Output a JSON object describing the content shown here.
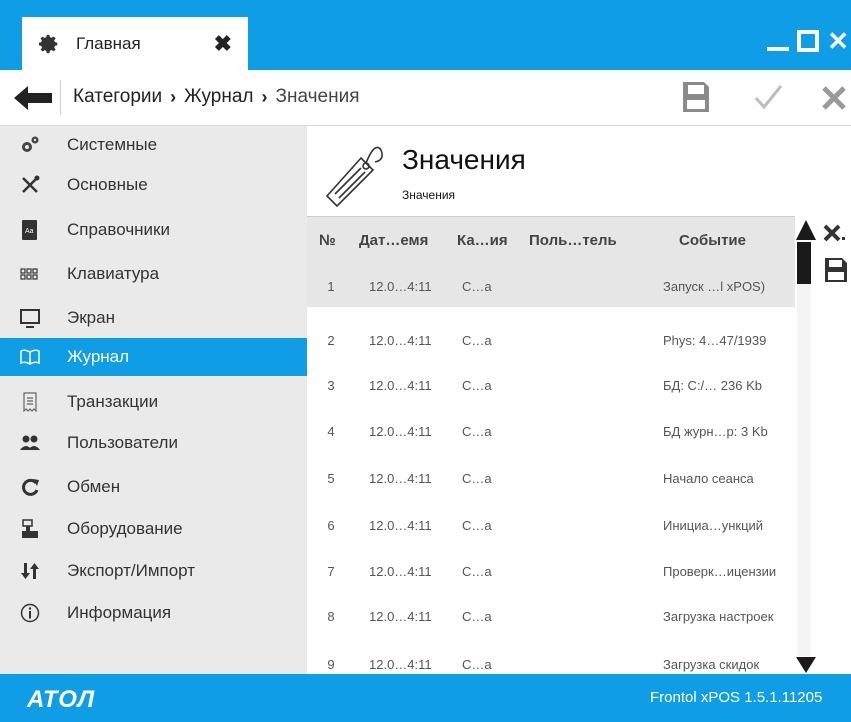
{
  "tab": {
    "title": "Главная",
    "close_glyph": "✖",
    "icon": "gear-icon"
  },
  "window": {
    "close_glyph": "✕"
  },
  "breadcrumb": {
    "back_icon": "back-arrow-icon",
    "items": [
      "Категории",
      "Журнал",
      "Значения"
    ],
    "separator": "›"
  },
  "actions": {
    "save_icon": "save-icon",
    "confirm_icon": "check-icon",
    "cancel_icon": "cancel-icon"
  },
  "sidebar": {
    "items": [
      {
        "label": "Системные",
        "icon": "gears-icon"
      },
      {
        "label": "Основные",
        "icon": "tools-icon"
      },
      {
        "label": "Справочники",
        "icon": "book-icon"
      },
      {
        "label": "Клавиатура",
        "icon": "keyboard-icon"
      },
      {
        "label": "Экран",
        "icon": "monitor-icon"
      },
      {
        "label": "Журнал",
        "icon": "journal-icon",
        "active": true
      },
      {
        "label": "Транзакции",
        "icon": "receipt-icon"
      },
      {
        "label": "Пользователи",
        "icon": "users-icon"
      },
      {
        "label": "Обмен",
        "icon": "sync-icon"
      },
      {
        "label": "Оборудование",
        "icon": "pos-terminal-icon"
      },
      {
        "label": "Экспорт/Импорт",
        "icon": "export-import-icon"
      },
      {
        "label": "Информация",
        "icon": "info-icon"
      }
    ]
  },
  "main": {
    "title": "Значения",
    "subtitle": "Значения",
    "header_icon": "tag-icon"
  },
  "grid": {
    "columns": [
      "№",
      "Дат…емя",
      "Ка…ия",
      "Поль…тель",
      "Событие"
    ],
    "rows": [
      {
        "no": "1",
        "date": "12.0…4:11",
        "cat": "С…а",
        "user": "",
        "event": "Запуск …l xPOS)",
        "selected": true
      },
      {
        "no": "2",
        "date": "12.0…4:11",
        "cat": "С…а",
        "user": "",
        "event": "Phys: 4…47/1939"
      },
      {
        "no": "3",
        "date": "12.0…4:11",
        "cat": "С…а",
        "user": "",
        "event": "БД: C:/… 236 Kb"
      },
      {
        "no": "4",
        "date": "12.0…4:11",
        "cat": "С…а",
        "user": "",
        "event": "БД журн…р: 3 Kb"
      },
      {
        "no": "5",
        "date": "12.0…4:11",
        "cat": "С…а",
        "user": "",
        "event": "Начало сеанса"
      },
      {
        "no": "6",
        "date": "12.0…4:11",
        "cat": "С…а",
        "user": "",
        "event": "Инициа…ункций"
      },
      {
        "no": "7",
        "date": "12.0…4:11",
        "cat": "С…а",
        "user": "",
        "event": "Проверк…ицензии"
      },
      {
        "no": "8",
        "date": "12.0…4:11",
        "cat": "С…а",
        "user": "",
        "event": "Загрузка настроек"
      },
      {
        "no": "9",
        "date": "12.0…4:11",
        "cat": "С…а",
        "user": "",
        "event": "Загрузка скидок"
      }
    ],
    "tools": {
      "clear_icon": "clear-filter-icon",
      "save_icon": "save-icon"
    }
  },
  "footer": {
    "logo": "АТОЛ",
    "version": "Frontol xPOS 1.5.1.11205"
  },
  "colors": {
    "accent": "#0f9ee6",
    "sidebar_bg": "#eaeaea",
    "selected_row": "#e6e6e6"
  }
}
